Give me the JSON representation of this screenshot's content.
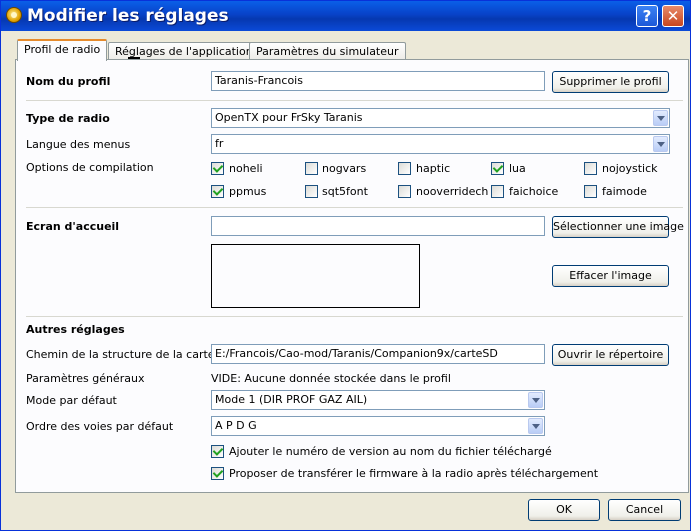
{
  "window": {
    "title": "Modifier les réglages",
    "help_label": "?",
    "close_label": "✕"
  },
  "tabs": [
    {
      "label": "Profil de radio",
      "active": true
    },
    {
      "label": "Réglages de l'application",
      "active": false
    },
    {
      "label": "Paramètres du simulateur",
      "active": false
    }
  ],
  "profile": {
    "name_label": "Nom du profil",
    "name_value": "Taranis-Francois",
    "delete_button": "Supprimer le profil",
    "radio_type_label": "Type de radio",
    "radio_type_value": "OpenTX pour FrSky Taranis",
    "menu_lang_label": "Langue des menus",
    "menu_lang_value": "fr",
    "build_options_label": "Options de compilation",
    "build_options": [
      {
        "label": "noheli",
        "checked": true
      },
      {
        "label": "nogvars",
        "checked": false
      },
      {
        "label": "haptic",
        "checked": false
      },
      {
        "label": "lua",
        "checked": true
      },
      {
        "label": "nojoystick",
        "checked": false
      },
      {
        "label": "ppmus",
        "checked": true
      },
      {
        "label": "sqt5font",
        "checked": false
      },
      {
        "label": "nooverridech",
        "checked": false
      },
      {
        "label": "faichoice",
        "checked": false
      },
      {
        "label": "faimode",
        "checked": false
      }
    ],
    "splash_label": "Ecran d'accueil",
    "splash_value": "",
    "select_image_button": "Sélectionner une image",
    "clear_image_button": "Effacer l'image",
    "other_settings_label": "Autres réglages",
    "sd_path_label": "Chemin de la structure de la carte SD",
    "sd_path_value": "E:/Francois/Cao-mod/Taranis/Companion9x/carteSD",
    "open_dir_button": "Ouvrir le répertoire",
    "general_params_label": "Paramètres généraux",
    "general_params_value": "VIDE: Aucune donnée stockée dans le profil",
    "default_mode_label": "Mode par défaut",
    "default_mode_value": "Mode 1 (DIR PROF GAZ AIL)",
    "channel_order_label": "Ordre des voies par défaut",
    "channel_order_value": "A P D G",
    "append_version": {
      "label": "Ajouter le numéro de version au nom du fichier téléchargé",
      "checked": true
    },
    "offer_flash": {
      "label": "Proposer de transférer le firmware à la radio après téléchargement",
      "checked": true
    }
  },
  "footer": {
    "ok_label": "OK",
    "cancel_label": "Cancel"
  }
}
